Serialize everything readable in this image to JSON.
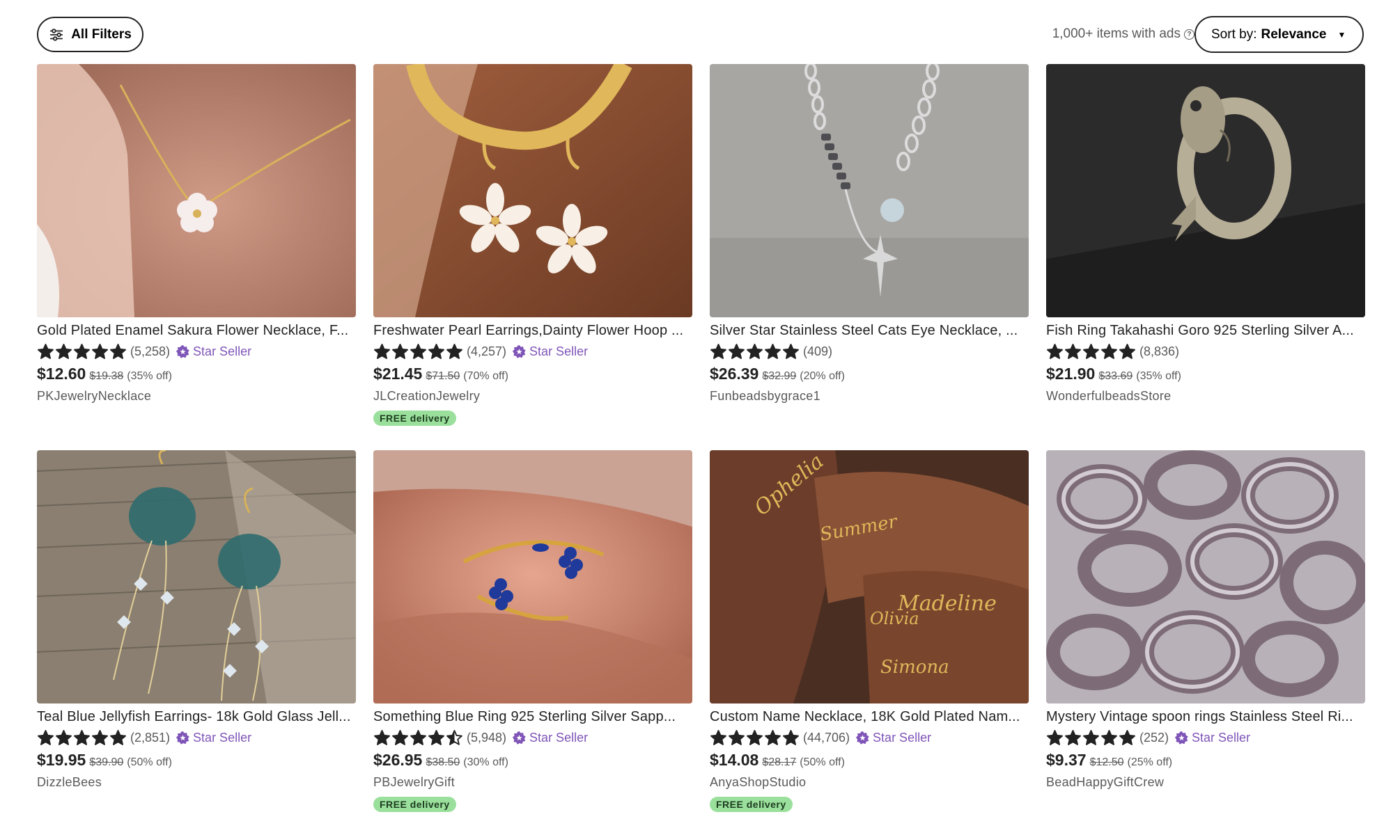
{
  "toolbar": {
    "filters_label": "All Filters",
    "ads_text": "1,000+ items with ads",
    "sort_label": "Sort by:",
    "sort_value": "Relevance"
  },
  "colors": {
    "star_seller": "#7f55b8",
    "free_delivery_bg": "#9ae09c",
    "text_primary": "#222222",
    "text_secondary": "#595959"
  },
  "products": [
    {
      "title": "Gold Plated Enamel Sakura Flower Necklace, F...",
      "rating": 5,
      "reviews": "(5,258)",
      "star_seller": "Star Seller",
      "price": "$12.60",
      "original_price": "$19.38",
      "discount": "(35% off)",
      "shop": "PKJewelryNecklace",
      "free_delivery": ""
    },
    {
      "title": "Freshwater Pearl Earrings,Dainty Flower Hoop ...",
      "rating": 5,
      "reviews": "(4,257)",
      "star_seller": "Star Seller",
      "price": "$21.45",
      "original_price": "$71.50",
      "discount": "(70% off)",
      "shop": "JLCreationJewelry",
      "free_delivery": "FREE delivery"
    },
    {
      "title": "Silver Star Stainless Steel Cats Eye Necklace, ...",
      "rating": 5,
      "reviews": "(409)",
      "star_seller": "",
      "price": "$26.39",
      "original_price": "$32.99",
      "discount": "(20% off)",
      "shop": "Funbeadsbygrace1",
      "free_delivery": ""
    },
    {
      "title": "Fish Ring Takahashi Goro 925 Sterling Silver A...",
      "rating": 5,
      "reviews": "(8,836)",
      "star_seller": "",
      "price": "$21.90",
      "original_price": "$33.69",
      "discount": "(35% off)",
      "shop": "WonderfulbeadsStore",
      "free_delivery": ""
    },
    {
      "title": "Teal Blue Jellyfish Earrings- 18k Gold Glass Jell...",
      "rating": 5,
      "reviews": "(2,851)",
      "star_seller": "Star Seller",
      "price": "$19.95",
      "original_price": "$39.90",
      "discount": "(50% off)",
      "shop": "DizzleBees",
      "free_delivery": ""
    },
    {
      "title": "Something Blue Ring 925 Sterling Silver Sapp...",
      "rating": 4.5,
      "reviews": "(5,948)",
      "star_seller": "Star Seller",
      "price": "$26.95",
      "original_price": "$38.50",
      "discount": "(30% off)",
      "shop": "PBJewelryGift",
      "free_delivery": "FREE delivery"
    },
    {
      "title": "Custom Name Necklace, 18K Gold Plated Nam...",
      "rating": 5,
      "reviews": "(44,706)",
      "star_seller": "Star Seller",
      "price": "$14.08",
      "original_price": "$28.17",
      "discount": "(50% off)",
      "shop": "AnyaShopStudio",
      "free_delivery": "FREE delivery"
    },
    {
      "title": "Mystery Vintage spoon rings Stainless Steel Ri...",
      "rating": 5,
      "reviews": "(252)",
      "star_seller": "Star Seller",
      "price": "$9.37",
      "original_price": "$12.50",
      "discount": "(25% off)",
      "shop": "BeadHappyGiftCrew",
      "free_delivery": ""
    }
  ],
  "necklace_names": [
    "Ophelia",
    "Summer",
    "Madeline",
    "Olivia",
    "Simona"
  ]
}
